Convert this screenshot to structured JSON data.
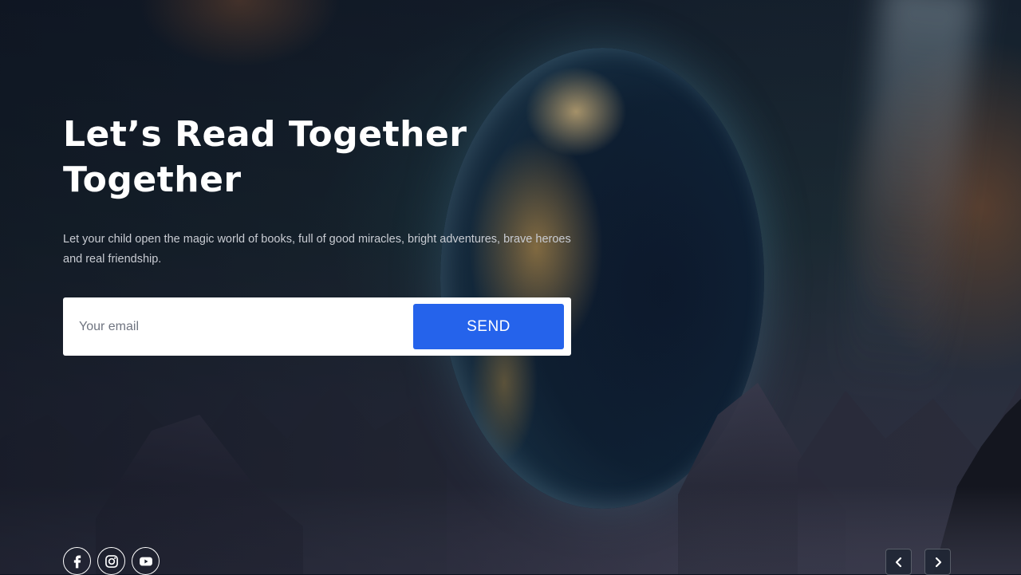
{
  "hero": {
    "title_line1": "Let’s Read Together",
    "title_line2": "Together",
    "subtitle": "Let your child open the magic world of books, full of good miracles, bright adventures, brave heroes and real friendship."
  },
  "subscribe": {
    "email_placeholder": "Your email",
    "send_label": "SEND",
    "send_color": "#2563eb"
  },
  "social": {
    "icons": [
      "facebook-icon",
      "instagram-icon",
      "youtube-icon"
    ]
  },
  "slider": {
    "prev_icon": "chevron-left-icon",
    "next_icon": "chevron-right-icon"
  }
}
